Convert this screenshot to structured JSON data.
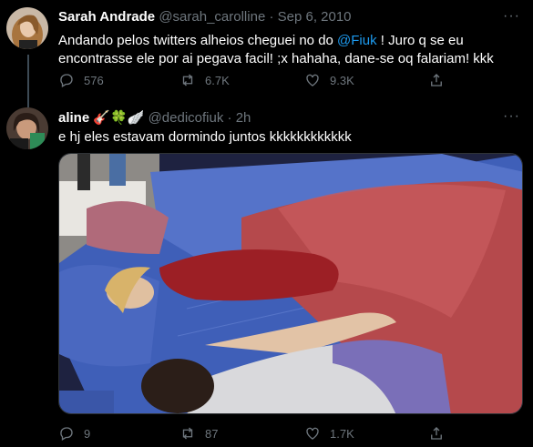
{
  "tweets": [
    {
      "name": "Sarah Andrade",
      "handle": "@sarah_carolline",
      "separator": "·",
      "time": "Sep 6, 2010",
      "text_before": "Andando pelos twitters alheios cheguei no do ",
      "mention": "@Fiuk",
      "text_after": " ! Juro q se eu encontrasse ele por ai pegava facil! ;x hahaha, dane-se oq falariam! kkk",
      "replies": "576",
      "retweets": "6.7K",
      "likes": "9.3K"
    },
    {
      "name": "aline",
      "emojis": "🎸🍀🪽",
      "handle": "@dedicofiuk",
      "separator": "·",
      "time": "2h",
      "text": "e hj eles estavam dormindo juntos kkkkkkkkkkkk",
      "replies": "9",
      "retweets": "87",
      "likes": "1.7K"
    }
  ],
  "more_label": "···",
  "icons": [
    "reply-icon",
    "retweet-icon",
    "like-icon",
    "share-icon"
  ],
  "colors": {
    "background": "#000000",
    "link": "#1d9bf0",
    "muted": "#6e767d",
    "text": "#ffffff"
  }
}
